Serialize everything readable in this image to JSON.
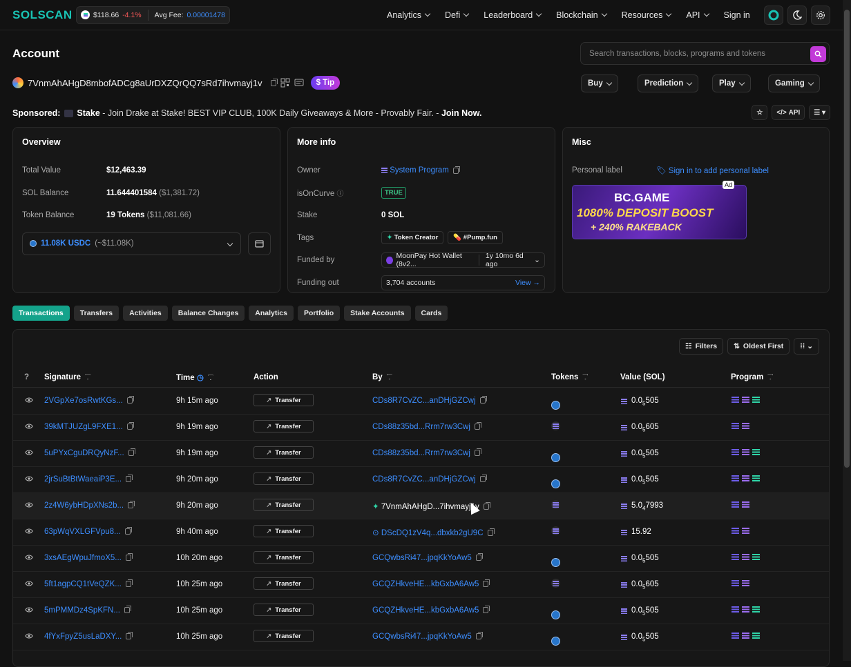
{
  "header": {
    "logo": "SOLSCAN",
    "sol_price": "$118.66",
    "sol_change": "-4.1%",
    "avg_fee_label": "Avg Fee:",
    "avg_fee_value": "0.00001478",
    "nav": [
      "Analytics",
      "Defi",
      "Leaderboard",
      "Blockchain",
      "Resources",
      "API"
    ],
    "sign_in": "Sign in"
  },
  "page": {
    "title": "Account",
    "search_placeholder": "Search transactions, blocks, programs and tokens",
    "address": "7VnmAhAHgD8mbofADCg8aUrDXZQrQQ7sRd7ihvmayj1v",
    "tip": "Tip",
    "dropdowns": [
      "Buy",
      "Prediction",
      "Play",
      "Gaming"
    ],
    "sponsored_label": "Sponsored:",
    "sponsor_name": "Stake",
    "sponsor_text": " - Join Drake at Stake! BEST VIP CLUB, 100K Daily Giveaways & More - Provably Fair. - ",
    "sponsor_cta": "Join Now.",
    "api_label": "API"
  },
  "overview": {
    "title": "Overview",
    "total_value_label": "Total Value",
    "total_value": "$12,463.39",
    "sol_balance_label": "SOL Balance",
    "sol_balance": "11.644401584",
    "sol_balance_usd": "($1,381.72)",
    "token_balance_label": "Token Balance",
    "token_balance": "19 Tokens",
    "token_balance_usd": "($11,081.66)",
    "token_select": "11.08K USDC",
    "token_select_usd": "(~$11.08K)"
  },
  "more_info": {
    "title": "More info",
    "owner_label": "Owner",
    "owner": "System Program",
    "is_on_curve_label": "isOnCurve",
    "is_on_curve": "TRUE",
    "stake_label": "Stake",
    "stake": "0 SOL",
    "tags_label": "Tags",
    "tags": [
      "Token Creator",
      "#Pump.fun"
    ],
    "funded_by_label": "Funded by",
    "funded_by": "MoonPay Hot Wallet (8v2...",
    "funded_age": "1y 10mo 6d ago",
    "funding_out_label": "Funding out",
    "funding_out": "3,704 accounts",
    "view": "View →"
  },
  "misc": {
    "title": "Misc",
    "personal_label": "Personal label",
    "personal_link": "Sign in to add personal label",
    "ad_tag": "Ad",
    "ad_line1": "BC.GAME",
    "ad_line2": "1080% DEPOSIT BOOST",
    "ad_line3": "+ 240% RAKEBACK"
  },
  "tabs": [
    "Transactions",
    "Transfers",
    "Activities",
    "Balance Changes",
    "Analytics",
    "Portfolio",
    "Stake Accounts",
    "Cards"
  ],
  "table": {
    "filters": "Filters",
    "sort": "Oldest First",
    "headers": [
      "Signature",
      "Time",
      "Action",
      "By",
      "Tokens",
      "Value (SOL)",
      "Program"
    ],
    "rows": [
      {
        "sig": "2VGpXe7osRwtKGs...",
        "time": "9h 15m ago",
        "action": "Transfer",
        "by": "CDs8R7CvZC...anDHjGZCwj",
        "token": "usdc",
        "val_a": "0.0",
        "val_sub": "5",
        "val_b": "505",
        "progs": 3
      },
      {
        "sig": "39kMTJUZgL9FXE1...",
        "time": "9h 19m ago",
        "action": "Transfer",
        "by": "CDs88z35bd...Rrm7rw3Cwj",
        "token": "sol",
        "val_a": "0.0",
        "val_sub": "5",
        "val_b": "605",
        "progs": 2
      },
      {
        "sig": "5uPYxCguDRQyNzF...",
        "time": "9h 19m ago",
        "action": "Transfer",
        "by": "CDs88z35bd...Rrm7rw3Cwj",
        "token": "usdc",
        "val_a": "0.0",
        "val_sub": "5",
        "val_b": "505",
        "progs": 3
      },
      {
        "sig": "2jrSuBtBtWaeaiP3E...",
        "time": "9h 20m ago",
        "action": "Transfer",
        "by": "CDs8R7CvZC...anDHjGZCwj",
        "token": "usdc",
        "val_a": "0.0",
        "val_sub": "5",
        "val_b": "505",
        "progs": 3
      },
      {
        "sig": "2z4W6ybHDpXNs2b...",
        "time": "9h 20m ago",
        "action": "Transfer",
        "by": "7VnmAhAHgD...7ihvmayj1v",
        "token": "sol",
        "val_a": "5.0",
        "val_sub": "4",
        "val_b": "7993",
        "progs": 2
      },
      {
        "sig": "63pWqVXLGFVpu8...",
        "time": "9h 40m ago",
        "action": "Transfer",
        "by": "DScDQ1zV4q...dbxkb2gU9C",
        "token": "sol",
        "val_a": "15.92",
        "val_sub": "",
        "val_b": "",
        "progs": 2
      },
      {
        "sig": "3xsAEgWpuJfmoX5...",
        "time": "10h 20m ago",
        "action": "Transfer",
        "by": "GCQwbsRi47...jpqKkYoAw5",
        "token": "usdc",
        "val_a": "0.0",
        "val_sub": "5",
        "val_b": "505",
        "progs": 3
      },
      {
        "sig": "5ft1agpCQ1tVeQZK...",
        "time": "10h 25m ago",
        "action": "Transfer",
        "by": "GCQZHkveHE...kbGxbA6Aw5",
        "token": "sol",
        "val_a": "0.0",
        "val_sub": "5",
        "val_b": "605",
        "progs": 2
      },
      {
        "sig": "5mPMMDz4SpKFN...",
        "time": "10h 25m ago",
        "action": "Transfer",
        "by": "GCQZHkveHE...kbGxbA6Aw5",
        "token": "usdc",
        "val_a": "0.0",
        "val_sub": "5",
        "val_b": "505",
        "progs": 3
      },
      {
        "sig": "4fYxFpyZ5usLaDXY...",
        "time": "10h 25m ago",
        "action": "Transfer",
        "by": "GCQwbsRi47...jpqKkYoAw5",
        "token": "usdc",
        "val_a": "0.0",
        "val_sub": "5",
        "val_b": "505",
        "progs": 3
      }
    ]
  },
  "colors": {
    "accent": "#14a38b",
    "link": "#3d8eff",
    "negative": "#ff5a5a",
    "brand": "#19c3b4"
  }
}
